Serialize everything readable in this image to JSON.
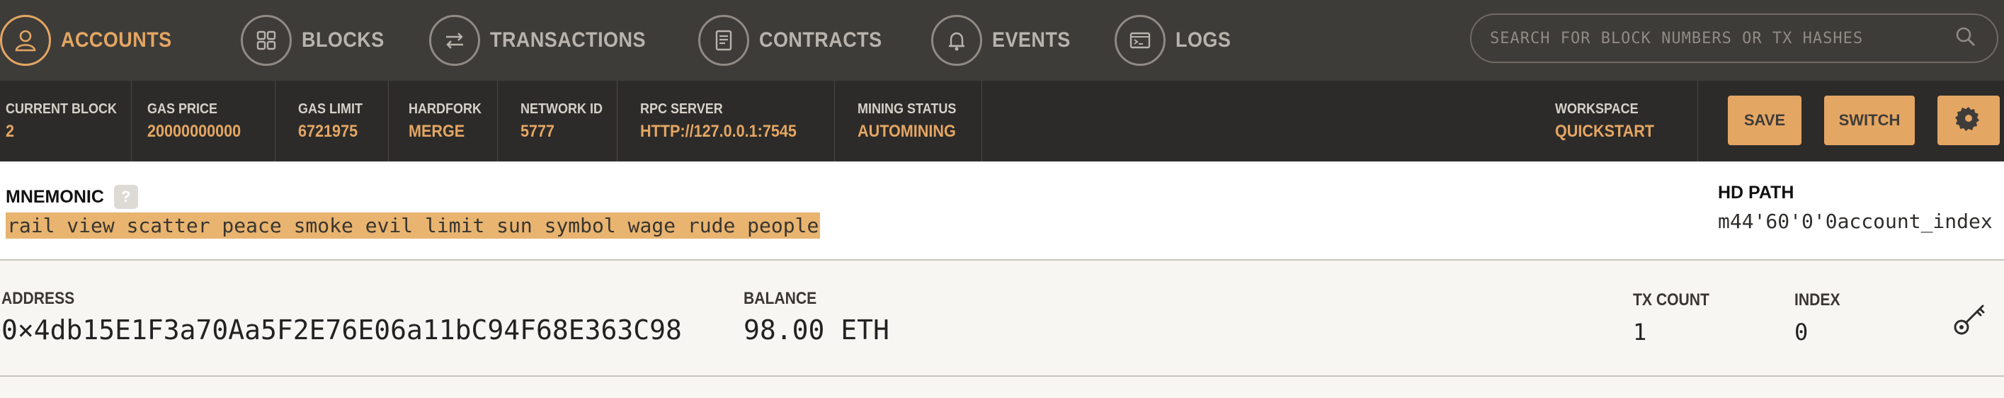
{
  "nav": {
    "items": [
      {
        "label": "ACCOUNTS",
        "icon": "person-icon",
        "active": true
      },
      {
        "label": "BLOCKS",
        "icon": "grid-icon",
        "active": false
      },
      {
        "label": "TRANSACTIONS",
        "icon": "swap-arrows-icon",
        "active": false
      },
      {
        "label": "CONTRACTS",
        "icon": "document-icon",
        "active": false
      },
      {
        "label": "EVENTS",
        "icon": "bell-icon",
        "active": false
      },
      {
        "label": "LOGS",
        "icon": "terminal-icon",
        "active": false
      }
    ],
    "search_placeholder": "SEARCH FOR BLOCK NUMBERS OR TX HASHES"
  },
  "status": {
    "current_block": {
      "label": "CURRENT BLOCK",
      "value": "2"
    },
    "gas_price": {
      "label": "GAS PRICE",
      "value": "20000000000"
    },
    "gas_limit": {
      "label": "GAS LIMIT",
      "value": "6721975"
    },
    "hardfork": {
      "label": "HARDFORK",
      "value": "MERGE"
    },
    "network_id": {
      "label": "NETWORK ID",
      "value": "5777"
    },
    "rpc_server": {
      "label": "RPC SERVER",
      "value": "HTTP://127.0.0.1:7545"
    },
    "mining_status": {
      "label": "MINING STATUS",
      "value": "AUTOMINING"
    },
    "workspace": {
      "label": "WORKSPACE",
      "value": "QUICKSTART"
    },
    "save_label": "SAVE",
    "switch_label": "SWITCH"
  },
  "mnemonic": {
    "label": "MNEMONIC",
    "help": "?",
    "words": "rail view scatter peace smoke evil limit sun symbol wage rude people",
    "hd_path_label": "HD PATH",
    "hd_path_value": "m44'60'0'0account_index"
  },
  "account": {
    "address_label": "ADDRESS",
    "address": "0×4db15E1F3a70Aa5F2E76E06a11bC94F68E363C98",
    "balance_label": "BALANCE",
    "balance": "98.00 ETH",
    "tx_count_label": "TX COUNT",
    "tx_count": "1",
    "index_label": "INDEX",
    "index": "0"
  },
  "colors": {
    "accent": "#e4a663",
    "nav_bg": "#3e3c39",
    "status_bg": "#2d2b29"
  }
}
